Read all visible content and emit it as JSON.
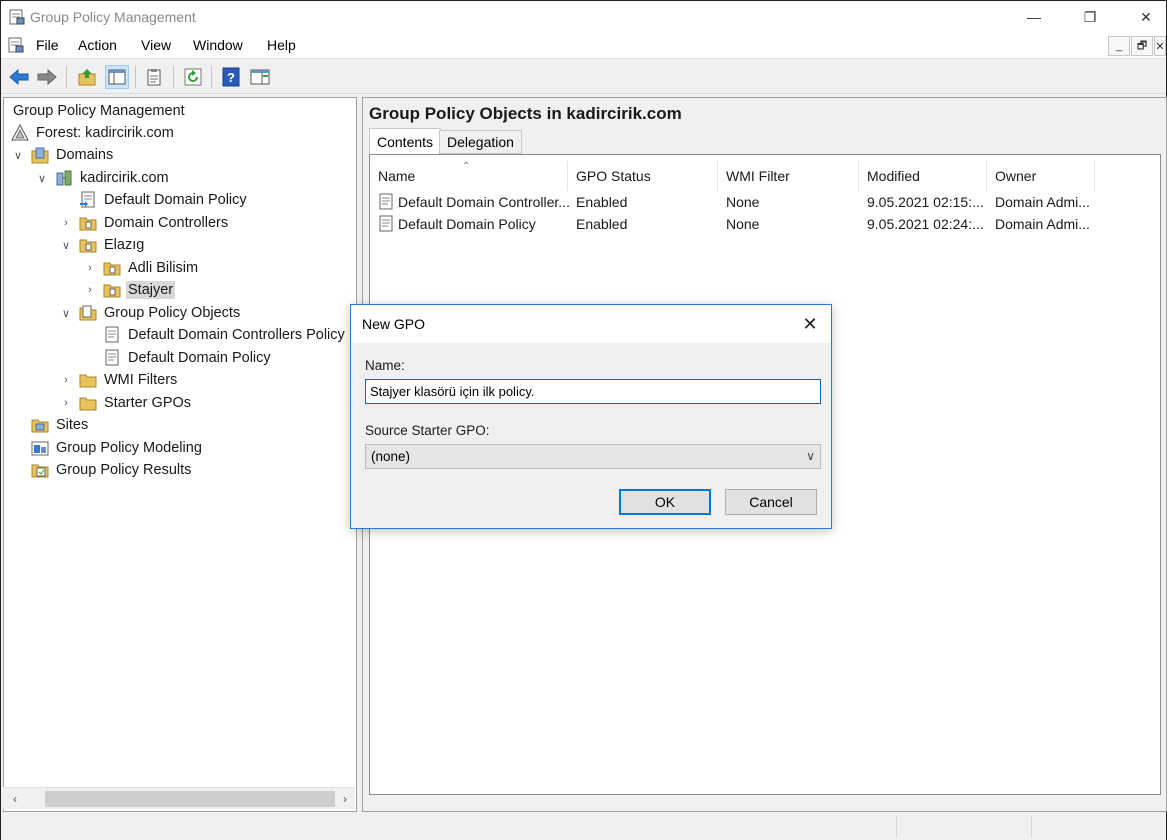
{
  "window": {
    "title": "Group Policy Management",
    "controls": {
      "minimize": "—",
      "restore": "❐",
      "close": "✕"
    }
  },
  "menu": {
    "items": [
      "File",
      "Action",
      "View",
      "Window",
      "Help"
    ],
    "mdi_controls": [
      "_",
      "🗗",
      "✕"
    ]
  },
  "toolbar": {
    "icons": [
      "back-arrow-icon",
      "forward-arrow-icon",
      "up-folder-icon",
      "show-hide-console-tree-icon",
      "properties-icon",
      "refresh-icon",
      "help-icon",
      "show-action-pane-icon"
    ]
  },
  "tree": {
    "root": "Group Policy Management",
    "forest": "Forest: kadircirik.com",
    "domains": "Domains",
    "domain": "kadircirik.com",
    "default_domain_policy": "Default Domain Policy",
    "domain_controllers": "Domain Controllers",
    "elazig": "Elazıg",
    "adli_bilisim": "Adli Bilisim",
    "stajyer": "Stajyer",
    "gpo_container": "Group Policy Objects",
    "gpo_ddcp": "Default Domain Controllers Policy",
    "gpo_ddp": "Default Domain Policy",
    "wmi_filters": "WMI Filters",
    "starter_gpos": "Starter GPOs",
    "sites": "Sites",
    "modeling": "Group Policy Modeling",
    "results": "Group Policy Results"
  },
  "right_pane": {
    "title": "Group Policy Objects in kadircirik.com",
    "tabs": [
      "Contents",
      "Delegation"
    ],
    "columns": [
      "Name",
      "GPO Status",
      "WMI Filter",
      "Modified",
      "Owner"
    ],
    "rows": [
      [
        "Default Domain Controller...",
        "Enabled",
        "None",
        "9.05.2021 02:15:...",
        "Domain Admi..."
      ],
      [
        "Default Domain Policy",
        "Enabled",
        "None",
        "9.05.2021 02:24:...",
        "Domain Admi..."
      ]
    ]
  },
  "dialog": {
    "title": "New GPO",
    "name_label": "Name:",
    "name_value": "Stajyer klasörü için ilk policy.",
    "starter_label": "Source Starter GPO:",
    "starter_value": "(none)",
    "ok_label": "OK",
    "cancel_label": "Cancel"
  },
  "colors": {
    "accent": "#0078d7",
    "folder": "#e8c25a",
    "selection": "#d9d9d9"
  }
}
